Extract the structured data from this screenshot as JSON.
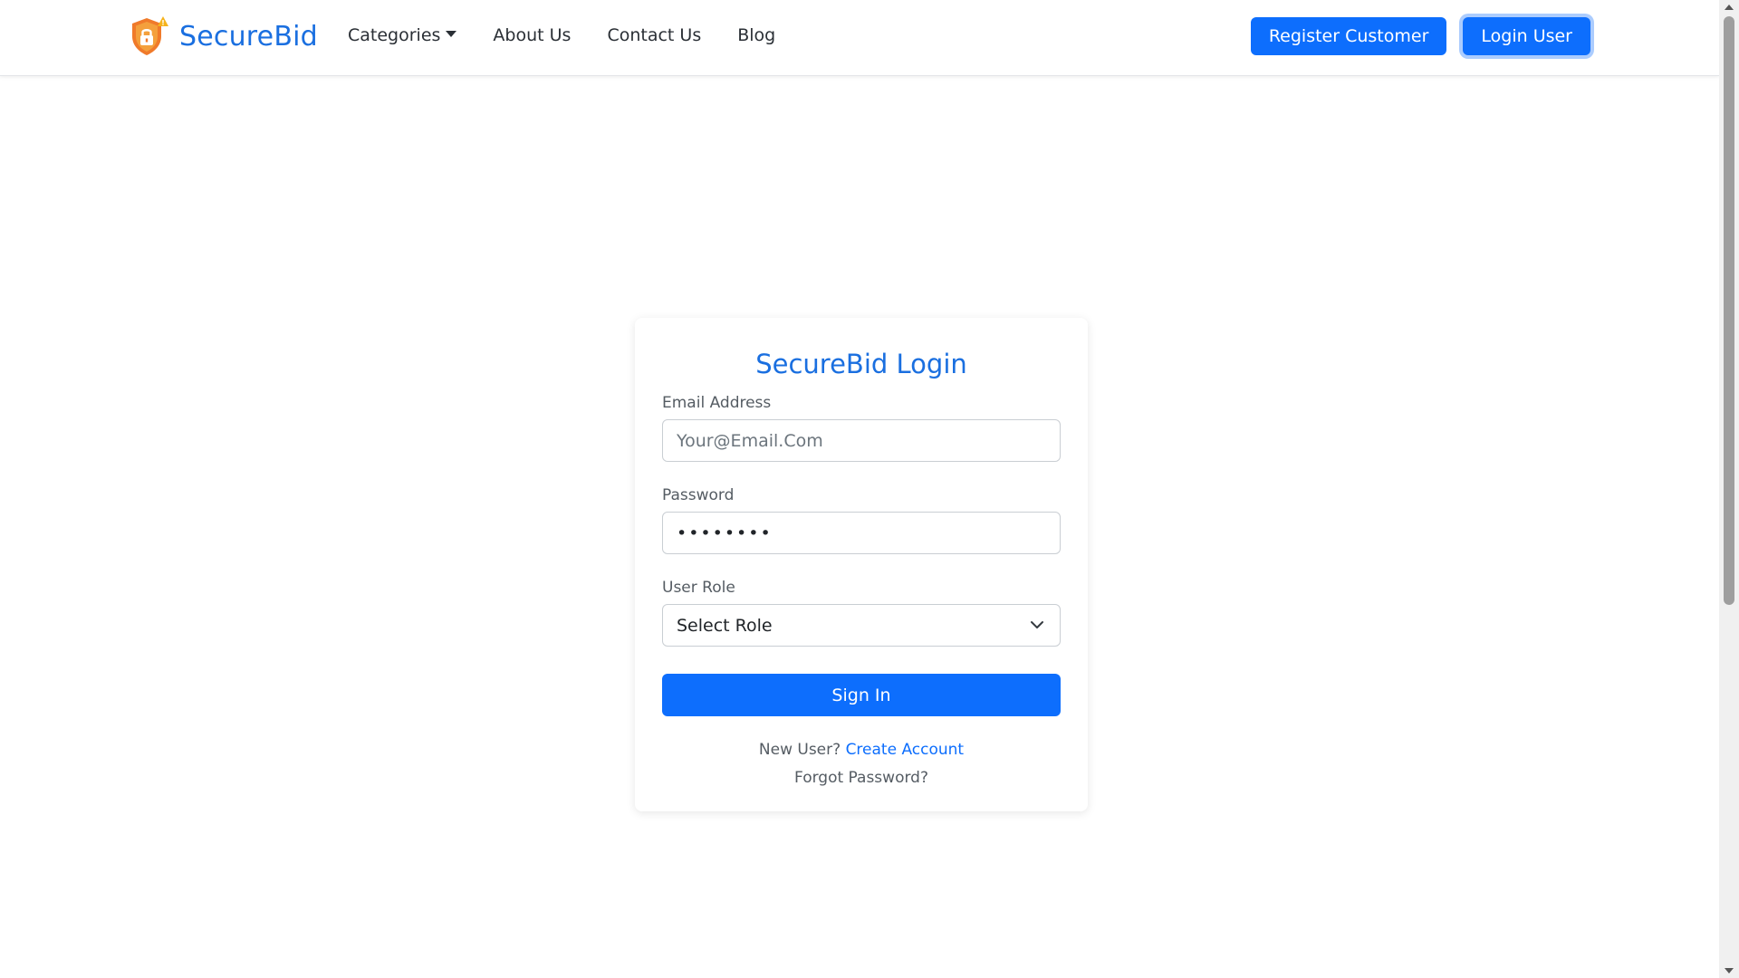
{
  "brand": {
    "name": "SecureBid",
    "logo_icon": "shield-lock-icon",
    "accent_color": "#1a6fe0"
  },
  "nav": {
    "items": [
      {
        "label": "Categories",
        "has_dropdown": true
      },
      {
        "label": "About Us"
      },
      {
        "label": "Contact Us"
      },
      {
        "label": "Blog"
      }
    ],
    "register_label": "Register Customer",
    "login_label": "Login User"
  },
  "login": {
    "title": "SecureBid Login",
    "email_label": "Email Address",
    "email_placeholder": "Your@Email.Com",
    "password_label": "Password",
    "password_value": "••••••••",
    "role_label": "User Role",
    "role_selected": "Select Role",
    "submit_label": "Sign In",
    "new_user_text": "New User?",
    "create_account_label": "Create Account",
    "forgot_password_label": "Forgot Password?"
  },
  "colors": {
    "primary": "#0d6efd"
  }
}
